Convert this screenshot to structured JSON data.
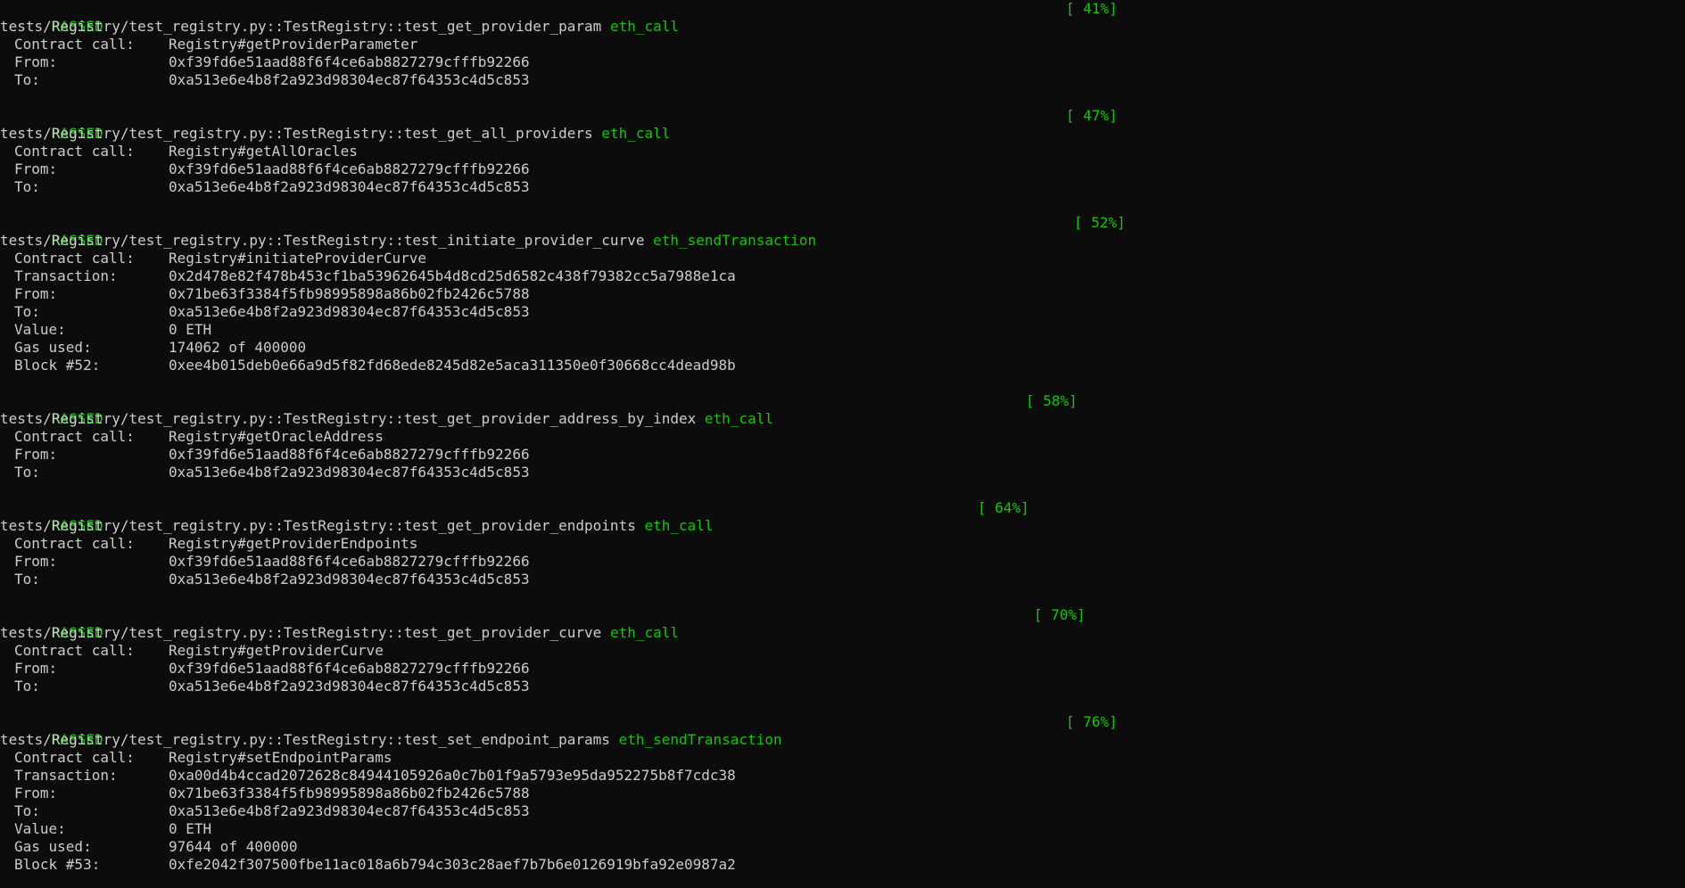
{
  "terminal": {
    "colors": {
      "background": "#0c0c0c",
      "text": "#cccccc",
      "accent_green": "#16c60c"
    },
    "blocks": [
      {
        "status": "PASSED",
        "percent": "[ 41%]",
        "test": "tests/Registry/test_registry.py::TestRegistry::test_get_provider_param",
        "method": "eth_call",
        "details": [
          {
            "key": "Contract call:",
            "value": "Registry#getProviderParameter"
          },
          {
            "key": "From:",
            "value": "0xf39fd6e51aad88f6f4ce6ab8827279cfffb92266"
          },
          {
            "key": "To:",
            "value": "0xa513e6e4b8f2a923d98304ec87f64353c4d5c853"
          }
        ]
      },
      {
        "status": "PASSED",
        "percent": "[ 47%]",
        "test": "tests/Registry/test_registry.py::TestRegistry::test_get_all_providers",
        "method": "eth_call",
        "details": [
          {
            "key": "Contract call:",
            "value": "Registry#getAllOracles"
          },
          {
            "key": "From:",
            "value": "0xf39fd6e51aad88f6f4ce6ab8827279cfffb92266"
          },
          {
            "key": "To:",
            "value": "0xa513e6e4b8f2a923d98304ec87f64353c4d5c853"
          }
        ]
      },
      {
        "status": "PASSED",
        "percent": "[ 52%]",
        "test": "tests/Registry/test_registry.py::TestRegistry::test_initiate_provider_curve",
        "method": "eth_sendTransaction",
        "details": [
          {
            "key": "Contract call:",
            "value": "Registry#initiateProviderCurve"
          },
          {
            "key": "Transaction:",
            "value": "0x2d478e82f478b453cf1ba53962645b4d8cd25d6582c438f79382cc5a7988e1ca"
          },
          {
            "key": "From:",
            "value": "0x71be63f3384f5fb98995898a86b02fb2426c5788"
          },
          {
            "key": "To:",
            "value": "0xa513e6e4b8f2a923d98304ec87f64353c4d5c853"
          },
          {
            "key": "Value:",
            "value": "0 ETH"
          },
          {
            "key": "Gas used:",
            "value": "174062 of 400000"
          },
          {
            "key": "Block #52:",
            "value": "0xee4b015deb0e66a9d5f82fd68ede8245d82e5aca311350e0f30668cc4dead98b"
          }
        ]
      },
      {
        "status": "PASSED",
        "percent": "[ 58%]",
        "test": "tests/Registry/test_registry.py::TestRegistry::test_get_provider_address_by_index",
        "method": "eth_call",
        "details": [
          {
            "key": "Contract call:",
            "value": "Registry#getOracleAddress"
          },
          {
            "key": "From:",
            "value": "0xf39fd6e51aad88f6f4ce6ab8827279cfffb92266"
          },
          {
            "key": "To:",
            "value": "0xa513e6e4b8f2a923d98304ec87f64353c4d5c853"
          }
        ]
      },
      {
        "status": "PASSED",
        "percent": "[ 64%]",
        "test": "tests/Registry/test_registry.py::TestRegistry::test_get_provider_endpoints",
        "method": "eth_call",
        "details": [
          {
            "key": "Contract call:",
            "value": "Registry#getProviderEndpoints"
          },
          {
            "key": "From:",
            "value": "0xf39fd6e51aad88f6f4ce6ab8827279cfffb92266"
          },
          {
            "key": "To:",
            "value": "0xa513e6e4b8f2a923d98304ec87f64353c4d5c853"
          }
        ]
      },
      {
        "status": "PASSED",
        "percent": "[ 70%]",
        "test": "tests/Registry/test_registry.py::TestRegistry::test_get_provider_curve",
        "method": "eth_call",
        "details": [
          {
            "key": "Contract call:",
            "value": "Registry#getProviderCurve"
          },
          {
            "key": "From:",
            "value": "0xf39fd6e51aad88f6f4ce6ab8827279cfffb92266"
          },
          {
            "key": "To:",
            "value": "0xa513e6e4b8f2a923d98304ec87f64353c4d5c853"
          }
        ]
      },
      {
        "status": "PASSED",
        "percent": "[ 76%]",
        "test": "tests/Registry/test_registry.py::TestRegistry::test_set_endpoint_params",
        "method": "eth_sendTransaction",
        "details": [
          {
            "key": "Contract call:",
            "value": "Registry#setEndpointParams"
          },
          {
            "key": "Transaction:",
            "value": "0xa00d4b4ccad2072628c84944105926a0c7b01f9a5793e95da952275b8f7cdc38"
          },
          {
            "key": "From:",
            "value": "0x71be63f3384f5fb98995898a86b02fb2426c5788"
          },
          {
            "key": "To:",
            "value": "0xa513e6e4b8f2a923d98304ec87f64353c4d5c853"
          },
          {
            "key": "Value:",
            "value": "0 ETH"
          },
          {
            "key": "Gas used:",
            "value": "97644 of 400000"
          },
          {
            "key": "Block #53:",
            "value": "0xfe2042f307500fbe11ac018a6b794c303c28aef7b7b6e0126919bfa92e0987a2"
          }
        ]
      }
    ]
  }
}
